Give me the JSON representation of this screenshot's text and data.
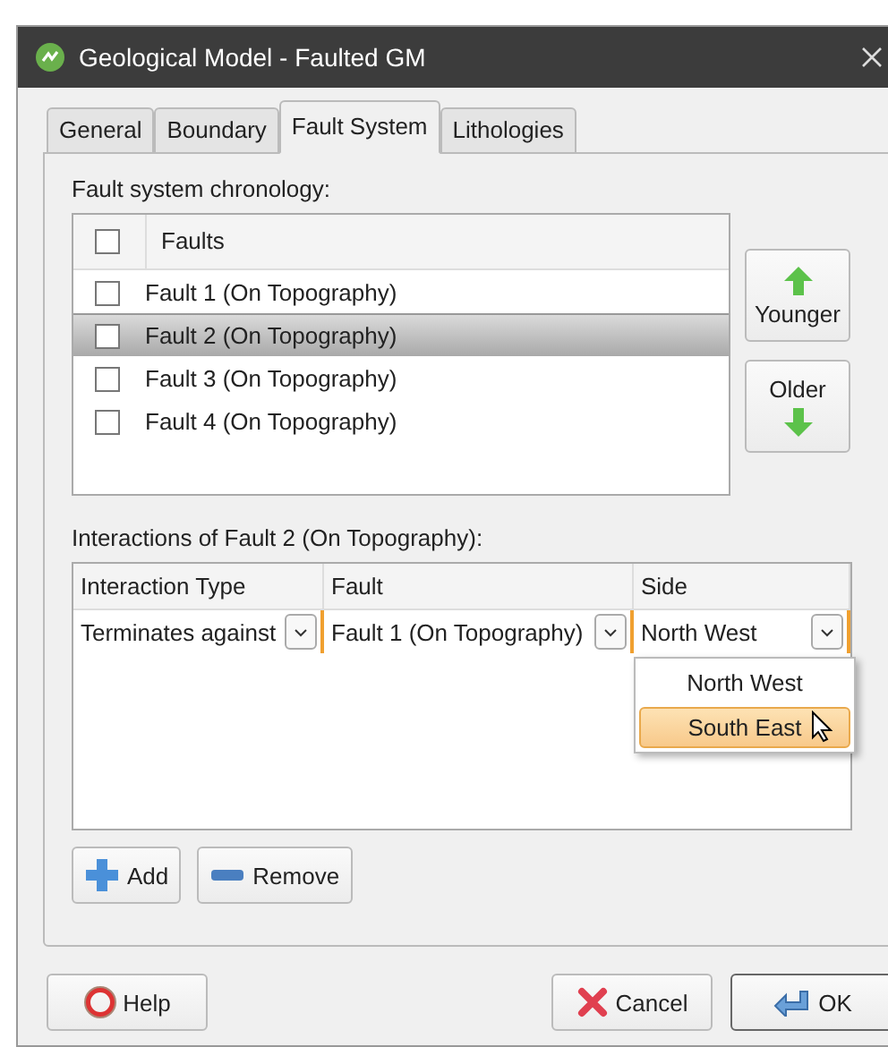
{
  "window": {
    "title": "Geological Model - Faulted GM"
  },
  "tabs": [
    {
      "label": "General",
      "selected": false
    },
    {
      "label": "Boundary",
      "selected": false
    },
    {
      "label": "Fault System",
      "selected": true
    },
    {
      "label": "Lithologies",
      "selected": false
    }
  ],
  "chronology": {
    "label": "Fault system chronology:",
    "header": "Faults",
    "header_checked": false,
    "rows": [
      {
        "name": "Fault 1 (On Topography)",
        "checked": false,
        "selected": false
      },
      {
        "name": "Fault 2 (On Topography)",
        "checked": false,
        "selected": true
      },
      {
        "name": "Fault 3 (On Topography)",
        "checked": false,
        "selected": false
      },
      {
        "name": "Fault 4 (On Topography)",
        "checked": false,
        "selected": false
      }
    ],
    "younger_button": "Younger",
    "older_button": "Older"
  },
  "interactions": {
    "label": "Interactions of Fault 2 (On Topography):",
    "columns": [
      "Interaction Type",
      "Fault",
      "Side"
    ],
    "rows": [
      {
        "interaction_type": "Terminates against",
        "fault": "Fault 1 (On Topography)",
        "side": "North West"
      }
    ],
    "dropdown": {
      "expanded": true,
      "options": [
        {
          "label": "North West",
          "selected": false
        },
        {
          "label": "South East",
          "selected": true
        }
      ]
    },
    "add_button": "Add",
    "remove_button": "Remove"
  },
  "footer": {
    "help_button": "Help",
    "cancel_button": "Cancel",
    "ok_button": "OK"
  }
}
